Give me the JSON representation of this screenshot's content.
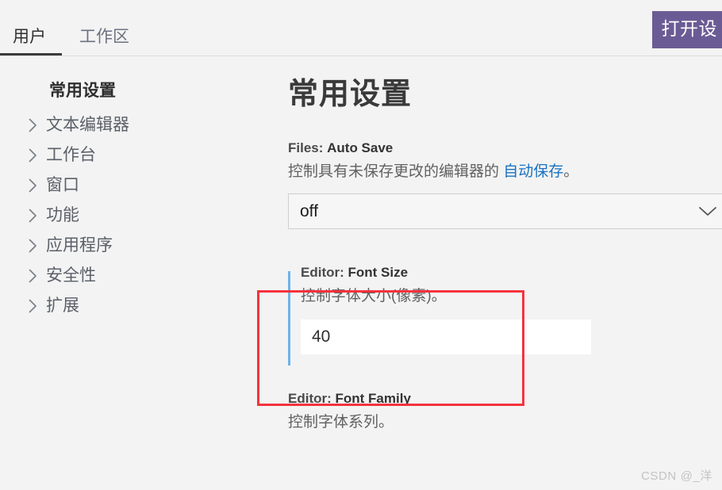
{
  "window": {
    "background_color": "#f3f3f3"
  },
  "tabbar": {
    "tabs": [
      {
        "label": "用户",
        "active": true
      },
      {
        "label": "工作区",
        "active": false
      }
    ],
    "open_settings_button": {
      "label": "打开设",
      "color": "#6b5b95"
    }
  },
  "sidebar": {
    "header": "常用设置",
    "items": [
      {
        "label": "文本编辑器",
        "icon": "chevron-right-icon"
      },
      {
        "label": "工作台",
        "icon": "chevron-right-icon"
      },
      {
        "label": "窗口",
        "icon": "chevron-right-icon"
      },
      {
        "label": "功能",
        "icon": "chevron-right-icon"
      },
      {
        "label": "应用程序",
        "icon": "chevron-right-icon"
      },
      {
        "label": "安全性",
        "icon": "chevron-right-icon"
      },
      {
        "label": "扩展",
        "icon": "chevron-right-icon"
      }
    ]
  },
  "main": {
    "page_title": "常用设置",
    "settings": [
      {
        "prefix": "Files: ",
        "name": "Auto Save",
        "desc_before": "控制具有未保存更改的编辑器的 ",
        "desc_link": "自动保存",
        "desc_after": "。",
        "control": "select",
        "value": "off",
        "chevron_icon": "chevron-down-icon"
      },
      {
        "prefix": "Editor: ",
        "name": "Font Size",
        "desc": "控制字体大小(像素)。",
        "control": "text",
        "value": "40",
        "modified": true,
        "accent_color": "#6cb3e8",
        "highlight_color": "#f5333f"
      },
      {
        "prefix": "Editor: ",
        "name": "Font Family",
        "desc": "控制字体系列。",
        "control": "none"
      }
    ]
  },
  "watermark": "CSDN @_洋"
}
